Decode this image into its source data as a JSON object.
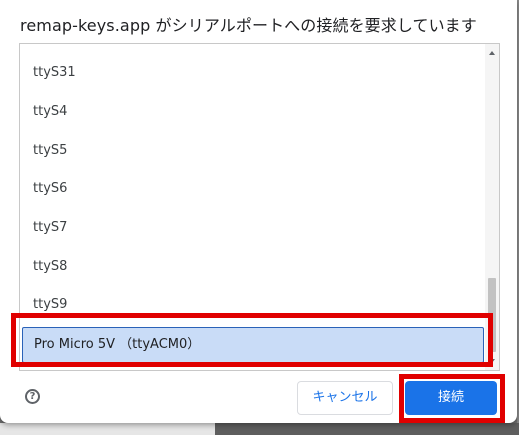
{
  "dialog": {
    "title": "remap-keys.app がシリアルポートへの接続を要求しています"
  },
  "ports": [
    {
      "label": "ttyS31",
      "selected": false
    },
    {
      "label": "ttyS4",
      "selected": false
    },
    {
      "label": "ttyS5",
      "selected": false
    },
    {
      "label": "ttyS6",
      "selected": false
    },
    {
      "label": "ttyS7",
      "selected": false
    },
    {
      "label": "ttyS8",
      "selected": false
    },
    {
      "label": "ttyS9",
      "selected": false
    },
    {
      "label": "Pro Micro 5V （ttyACM0）",
      "selected": true
    }
  ],
  "footer": {
    "help_icon": "?",
    "cancel_label": "キャンセル",
    "connect_label": "接続"
  },
  "colors": {
    "accent": "#1a73e8",
    "selected_bg": "#c9dcf7",
    "annotation": "#e00000"
  },
  "icons": [
    "help-icon",
    "scroll-up-arrow-icon",
    "scroll-down-arrow-icon"
  ]
}
